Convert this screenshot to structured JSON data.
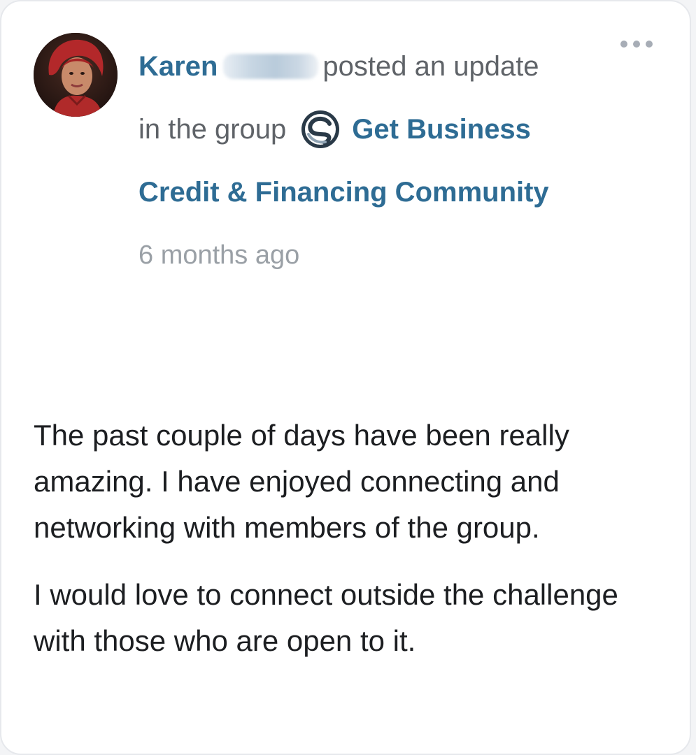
{
  "post": {
    "author_first_name": "Karen",
    "action_text": "posted an update",
    "group_prefix": "in the group",
    "group_name_line1": "Get Business",
    "group_name_line2": "Credit & Financing Community",
    "timestamp": "6 months ago",
    "paragraphs": [
      "The past couple of days have been really amazing. I have enjoyed connecting and networking with members of the group.",
      "I would love to connect outside the challenge with those who are open to it."
    ]
  },
  "icons": {
    "more": "more-options-icon",
    "group_logo": "group-logo-icon",
    "avatar": "author-avatar"
  },
  "colors": {
    "link": "#2e6c94",
    "meta_text": "#5f6368",
    "timestamp": "#9aa0a6",
    "body_text": "#1c1e21",
    "card_border": "#e6e8ec"
  }
}
